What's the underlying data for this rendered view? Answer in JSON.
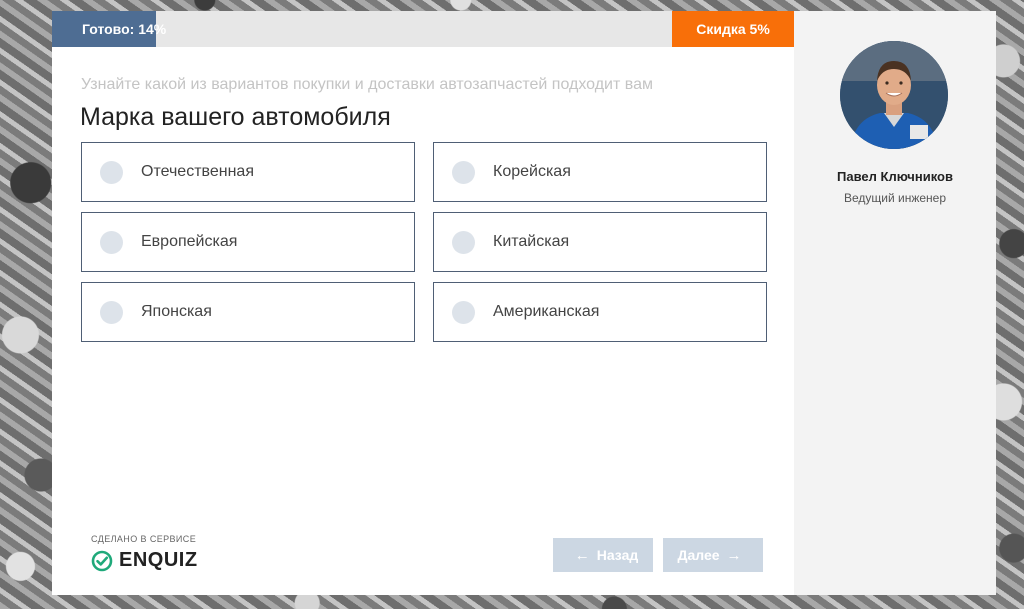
{
  "progress": {
    "label": "Готово: 14%",
    "fraction": 0.14
  },
  "discount": {
    "label": "Скидка 5%"
  },
  "quiz": {
    "subtitle": "Узнайте какой из вариантов покупки и доставки автозапчастей подходит вам",
    "question": "Марка вашего автомобиля",
    "options": [
      {
        "label": "Отечественная"
      },
      {
        "label": "Корейская"
      },
      {
        "label": "Европейская"
      },
      {
        "label": "Китайская"
      },
      {
        "label": "Японская"
      },
      {
        "label": "Американская"
      }
    ]
  },
  "footer": {
    "made_label": "СДЕЛАНО В СЕРВИСЕ",
    "logo_text": "ENQUIZ",
    "back_label": "Назад",
    "next_label": "Далее"
  },
  "consultant": {
    "name": "Павел Ключников",
    "role": "Ведущий инженер"
  },
  "icons": {
    "back": "arrow-left-icon",
    "next": "arrow-right-icon",
    "logo": "check-circle-icon"
  },
  "colors": {
    "progress": "#4e6d93",
    "discount": "#f86f09",
    "radio": "#dde3ea",
    "button": "#ccd7e3",
    "logo_check": "#1fa97a"
  }
}
